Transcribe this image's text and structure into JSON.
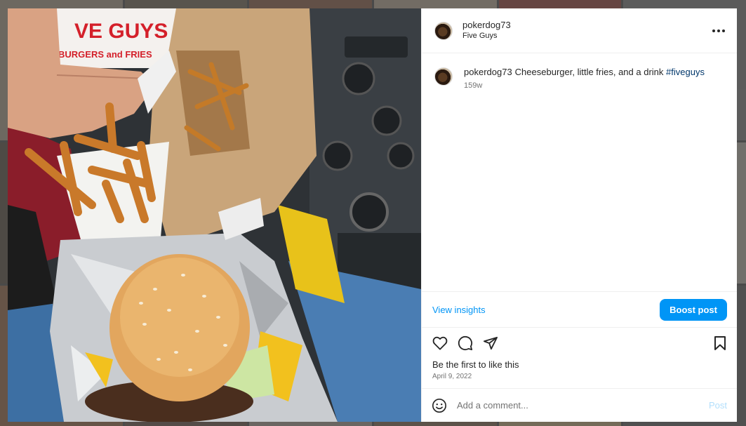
{
  "post": {
    "username": "pokerdog73",
    "location": "Five Guys",
    "more_icon": "more-horizontal-icon",
    "caption": {
      "username": "pokerdog73",
      "text": "Cheeseburger, little fries, and a drink",
      "hashtag": "#fiveguys",
      "time": "159w"
    },
    "photo": {
      "cup_text_line1": "VE GUYS",
      "cup_text_line2": "BURGERS and FRIES"
    },
    "insights": {
      "view_label": "View insights",
      "boost_label": "Boost post"
    },
    "actions": {
      "like_icon": "heart-icon",
      "comment_icon": "comment-icon",
      "share_icon": "share-icon",
      "save_icon": "bookmark-icon"
    },
    "likes_text": "Be the first to like this",
    "date": "April 9, 2022",
    "comment_box": {
      "emoji_icon": "emoji-icon",
      "placeholder": "Add a comment...",
      "post_label": "Post"
    }
  },
  "colors": {
    "accent": "#0095f6",
    "link": "#00376b",
    "post_disabled": "#b2dffc"
  }
}
